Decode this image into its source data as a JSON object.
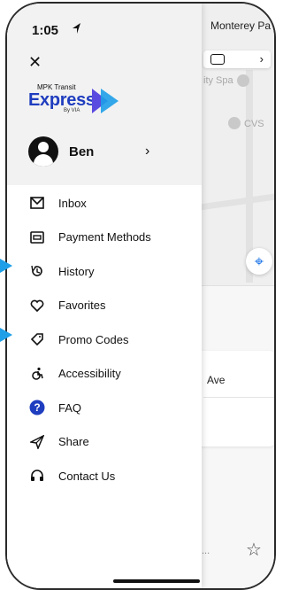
{
  "status_bar": {
    "time": "1:05",
    "right_text": "Monterey Pa"
  },
  "map": {
    "poi_spa": "ity Spa",
    "poi_cvs": "CVS",
    "card_text": "Ave",
    "footer_dots": "..."
  },
  "logo": {
    "small": "MPK Transit",
    "big": "Express",
    "by": "By VIA"
  },
  "profile": {
    "name": "Ben"
  },
  "menu": [
    {
      "label": "Inbox",
      "icon": "mail-icon"
    },
    {
      "label": "Payment Methods",
      "icon": "credit-card-icon"
    },
    {
      "label": "History",
      "icon": "history-icon"
    },
    {
      "label": "Favorites",
      "icon": "heart-icon"
    },
    {
      "label": "Promo Codes",
      "icon": "tag-icon"
    },
    {
      "label": "Accessibility",
      "icon": "accessibility-icon"
    },
    {
      "label": "FAQ",
      "icon": "help-icon"
    },
    {
      "label": "Share",
      "icon": "share-icon"
    },
    {
      "label": "Contact Us",
      "icon": "headset-icon"
    }
  ],
  "colors": {
    "brand_blue": "#1f3dbf",
    "accent_blue": "#1e9fe8",
    "pointer": "#1e9fe8"
  }
}
